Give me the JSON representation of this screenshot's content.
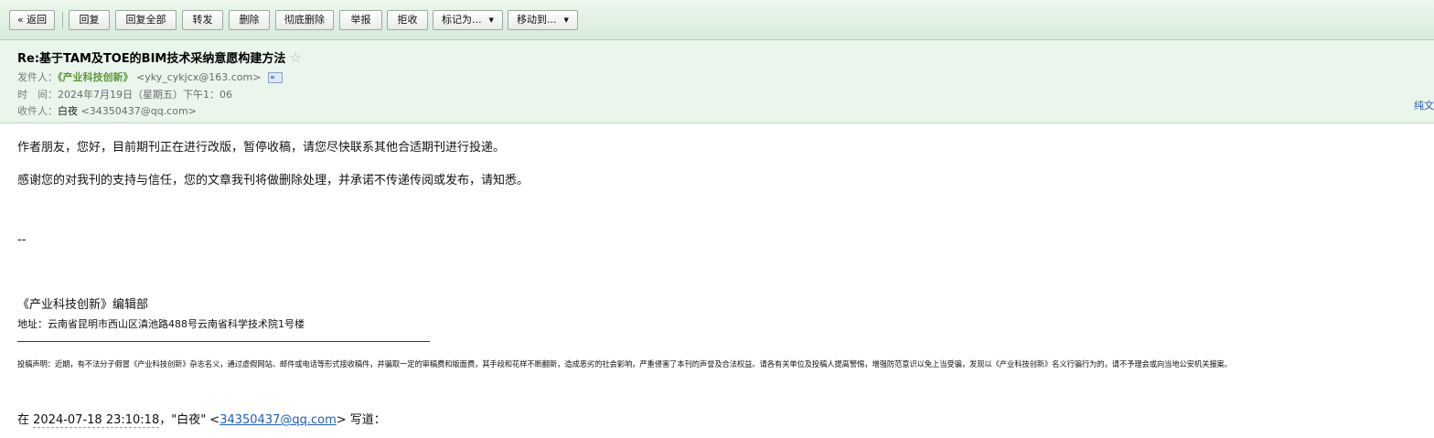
{
  "toolbar": {
    "back": "« 返回",
    "reply": "回复",
    "reply_all": "回复全部",
    "forward": "转发",
    "delete": "删除",
    "delete_forever": "彻底删除",
    "report": "举报",
    "reject": "拒收",
    "mark_as": "标记为...",
    "move_to": "移动到..."
  },
  "header": {
    "subject": "Re:基于TAM及TOE的BIM技术采纳意愿构建方法",
    "star": "☆",
    "from_label": "发件人：",
    "from_name": "《产业科技创新》",
    "from_email": "<yky_cykjcx@163.com>",
    "time_label": "时　间：",
    "time_value": "2024年7月19日（星期五）下午1：06",
    "to_label": "收件人：",
    "to_name": "白夜",
    "to_email": "<34350437@qq.com>",
    "plain_text_link": "纯文"
  },
  "body": {
    "line1": "作者朋友，您好，目前期刊正在进行改版，暂停收稿，请您尽快联系其他合适期刊进行投递。",
    "line2": "感谢您的对我刊的支持与信任，您的文章我刊将做删除处理，并承诺不传递传阅或发布，请知悉。",
    "signature_sep": "--",
    "dept": "《产业科技创新》编辑部",
    "address": "地址：云南省昆明市西山区滇池路488号云南省科学技术院1号楼",
    "notice": "投稿声明：近期，有不法分子假冒《产业科技创新》杂志名义，通过虚假网站、邮件或电话等形式接收稿件，并骗取一定的审稿费和版面费，其手段和花样不断翻新，造成恶劣的社会影响，严重侵害了本刊的声誉及合法权益。请各有关单位及投稿人提高警惕，增强防范意识以免上当受骗，发现以《产业科技创新》名义行骗行为的，请不予理会或向当地公安机关报案。",
    "quote_prefix": "在 ",
    "quote_timestamp": "2024-07-18 23:10:18",
    "quote_name": "，\"白夜\" <",
    "quote_email": "34350437@qq.com",
    "quote_suffix": "> 写道："
  }
}
